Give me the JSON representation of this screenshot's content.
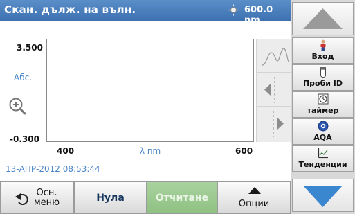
{
  "header": {
    "title": "Скан. дълж. на вълн.",
    "wavelength": "600.0 nm"
  },
  "chart_data": {
    "type": "line",
    "xlabel": "λ nm",
    "ylabel": "Абс.",
    "xlim": [
      400,
      600
    ],
    "ylim": [
      -0.3,
      3.5
    ],
    "x_tick_labels": [
      "400",
      "600"
    ],
    "y_tick_labels": [
      "3.500",
      "-0.300"
    ],
    "series": []
  },
  "datetime": "13-АПР-2012  08:53:44",
  "bottom_bar": {
    "home_line1": "Осн.",
    "home_line2": "меню",
    "zero": "Нула",
    "read": "Отчитане",
    "options": "Опции"
  },
  "right_panel": {
    "buttons": [
      {
        "label": "Вход",
        "icon": "user-icon"
      },
      {
        "label": "Проби ID",
        "icon": "sample-vial-icon"
      },
      {
        "label": "таймер",
        "icon": "timer-icon"
      },
      {
        "label": "AQA",
        "icon": "aqa-icon"
      },
      {
        "label": "Тенденции",
        "icon": "trend-icon"
      }
    ]
  },
  "colors": {
    "header": "#3d71b0",
    "accent_text": "#4a86c8",
    "disabled_button": "#8fc183"
  }
}
